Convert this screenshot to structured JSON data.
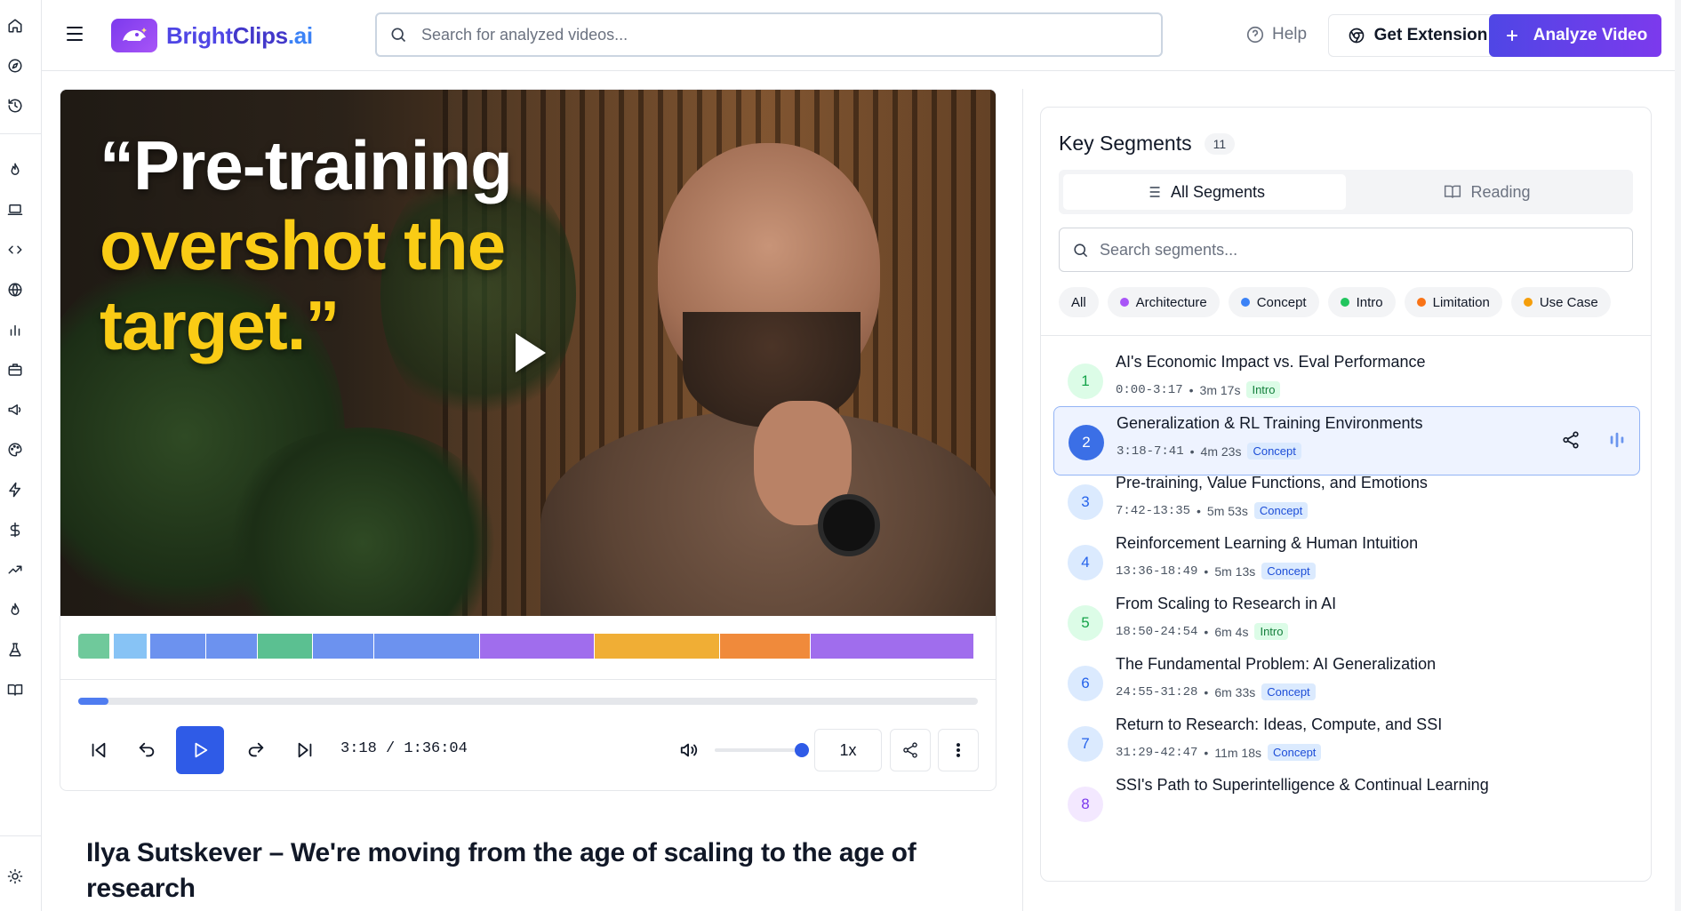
{
  "header": {
    "brand_part1": "Bright",
    "brand_part2": "Clips",
    "brand_part3": ".ai",
    "search_placeholder": "Search for analyzed videos...",
    "help_label": "Help",
    "extension_label": "Get Extension",
    "analyze_label": "Analyze Video"
  },
  "rail": {
    "icons": [
      "home-icon",
      "compass-icon",
      "history-icon",
      "flame-icon",
      "laptop-icon",
      "code-icon",
      "globe-icon",
      "bar-chart-icon",
      "briefcase-icon",
      "megaphone-icon",
      "palette-icon",
      "zap-icon",
      "dollar-icon",
      "trending-up-icon",
      "flame-icon",
      "flask-icon",
      "book-icon",
      "sun-icon"
    ]
  },
  "video": {
    "quote_line1": "“Pre-training",
    "quote_line2": "overshot the",
    "quote_line3": "target.”",
    "current_time": "3:18",
    "total_time": "1:36:04",
    "progress": 0.034,
    "volume": 1.0,
    "speed_label": "1x",
    "timeline_segments": [
      {
        "color": "#6fc99b",
        "start": 0.0,
        "end": 0.036
      },
      {
        "color": "#87c3f5",
        "start": 0.04,
        "end": 0.077
      },
      {
        "color": "#6c92ef",
        "start": 0.08,
        "end": 0.143
      },
      {
        "color": "#6c92ef",
        "start": 0.143,
        "end": 0.2
      },
      {
        "color": "#5bc091",
        "start": 0.2,
        "end": 0.262
      },
      {
        "color": "#6c92ef",
        "start": 0.262,
        "end": 0.33
      },
      {
        "color": "#6c92ef",
        "start": 0.33,
        "end": 0.448
      },
      {
        "color": "#a06ded",
        "start": 0.448,
        "end": 0.576
      },
      {
        "color": "#f0ae35",
        "start": 0.576,
        "end": 0.716
      },
      {
        "color": "#f08a3b",
        "start": 0.716,
        "end": 0.817
      },
      {
        "color": "#a06ded",
        "start": 0.817,
        "end": 1.0
      }
    ]
  },
  "page_title": "Ilya Sutskever – We're moving from the age of scaling to the age of research",
  "segments_panel": {
    "title": "Key Segments",
    "count": "11",
    "tab_all": "All Segments",
    "tab_reading": "Reading",
    "search_placeholder": "Search segments...",
    "filters": [
      {
        "label": "All",
        "color": ""
      },
      {
        "label": "Architecture",
        "color": "#a855f7"
      },
      {
        "label": "Concept",
        "color": "#3b82f6"
      },
      {
        "label": "Intro",
        "color": "#22c55e"
      },
      {
        "label": "Limitation",
        "color": "#f97316"
      },
      {
        "label": "Use Case",
        "color": "#f59e0b"
      }
    ],
    "items": [
      {
        "num": "1",
        "title": "AI's Economic Impact vs. Eval Performance",
        "range": "0:00-3:17",
        "duration": "3m 17s",
        "tag": "Intro"
      },
      {
        "num": "2",
        "title": "Generalization & RL Training Environments",
        "range": "3:18-7:41",
        "duration": "4m 23s",
        "tag": "Concept"
      },
      {
        "num": "3",
        "title": "Pre-training, Value Functions, and Emotions",
        "range": "7:42-13:35",
        "duration": "5m 53s",
        "tag": "Concept"
      },
      {
        "num": "4",
        "title": "Reinforcement Learning & Human Intuition",
        "range": "13:36-18:49",
        "duration": "5m 13s",
        "tag": "Concept"
      },
      {
        "num": "5",
        "title": "From Scaling to Research in AI",
        "range": "18:50-24:54",
        "duration": "6m 4s",
        "tag": "Intro"
      },
      {
        "num": "6",
        "title": "The Fundamental Problem: AI Generalization",
        "range": "24:55-31:28",
        "duration": "6m 33s",
        "tag": "Concept"
      },
      {
        "num": "7",
        "title": "Return to Research: Ideas, Compute, and SSI",
        "range": "31:29-42:47",
        "duration": "11m 18s",
        "tag": "Concept"
      },
      {
        "num": "8",
        "title": "SSI's Path to Superintelligence & Continual Learning",
        "range": "",
        "duration": "",
        "tag": ""
      }
    ]
  }
}
